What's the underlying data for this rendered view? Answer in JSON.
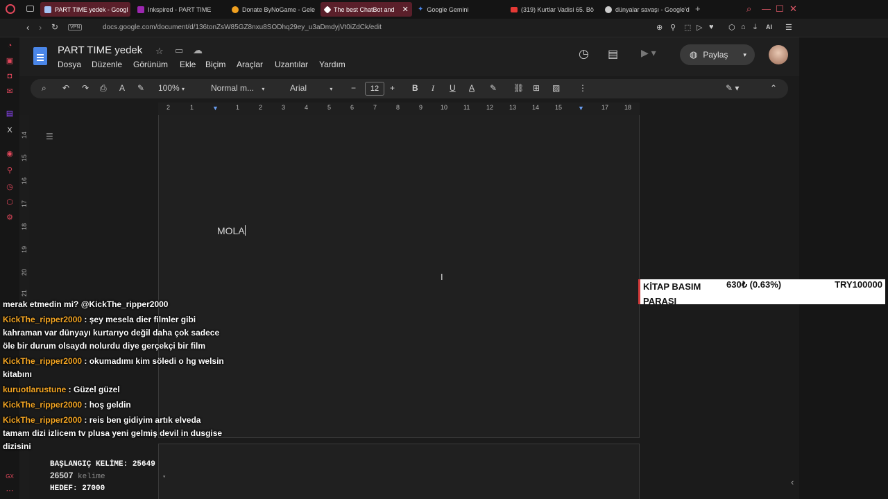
{
  "tabs": [
    {
      "label": "PART TIME yedek - Googl",
      "active": true,
      "color": "#a4c2f4"
    },
    {
      "label": "Inkspired - PART TIME",
      "active": false,
      "color": "#9c27b0"
    },
    {
      "label": "Donate ByNoGame - Gelen",
      "active": false,
      "color": "#f0a020"
    },
    {
      "label": "The best ChatBot and",
      "active": true,
      "color": "#ffffff"
    },
    {
      "label": "Google Gemini",
      "active": false,
      "color": "#4a86e8"
    },
    {
      "label": "(319) Kurtlar Vadisi 65. Bö",
      "active": false,
      "color": "#e53935"
    },
    {
      "label": "dünyalar savaşı - Google'd",
      "active": false,
      "color": "#cccccc"
    }
  ],
  "address": {
    "vpn": "VPN",
    "url": "docs.google.com/document/d/136tonZsW85GZ8nxu8SODhq29ey_u3aDmdyjVt0iZdCk/edit"
  },
  "doc": {
    "title": "PART TIME  yedek",
    "body_text": "MOLA"
  },
  "menus": [
    "Dosya",
    "Düzenle",
    "Görünüm",
    "Ekle",
    "Biçim",
    "Araçlar",
    "Uzantılar",
    "Yardım"
  ],
  "share": {
    "label": "Paylaş"
  },
  "toolbar": {
    "zoom": "100%",
    "style": "Normal m...",
    "font": "Arial",
    "size": "12"
  },
  "ruler": [
    "2",
    "1",
    "1",
    "1",
    "2",
    "3",
    "4",
    "5",
    "6",
    "7",
    "8",
    "9",
    "10",
    "11",
    "12",
    "13",
    "14",
    "15",
    "16",
    "17",
    "18"
  ],
  "vruler": [
    "14",
    "15",
    "16",
    "17",
    "18",
    "19",
    "20",
    "21"
  ],
  "overlay": {
    "label": "KİTAP BASIM PARASI",
    "value": "630₺ (0.63%)",
    "target": "TRY100000"
  },
  "chat": [
    {
      "user": "",
      "text": "merak etmedin mi? @KickThe_ripper2000"
    },
    {
      "user": "KickThe_ripper2000",
      "text": " : şey mesela dier filmler gibi kahraman var dünyayı kurtarıyo değil daha çok sadece öle bir durum olsaydı nolurdu diye gerçekçi bir film"
    },
    {
      "user": "KickThe_ripper2000",
      "text": " : okumadımı kim söledi o hg welsin kitabını"
    },
    {
      "user": "kuruotlarustune",
      "text": " : Güzel güzel"
    },
    {
      "user": "KickThe_ripper2000",
      "text": " : hoş geldin"
    },
    {
      "user": "KickThe_ripper2000",
      "text": " : reis ben gidiyim artık elveda tamam dizi izlicem tv plusa yeni gelmiş devil in dusgise dizisini"
    }
  ],
  "wordcount": {
    "start": "BAŞLANGIÇ KELİME: 25649",
    "current": "26507",
    "unit": "kelime",
    "target": "HEDEF: 27000"
  },
  "colors": {
    "accent": "#e2475b",
    "docs_blue": "#4a86e8",
    "chat_user": "#f5a623"
  }
}
